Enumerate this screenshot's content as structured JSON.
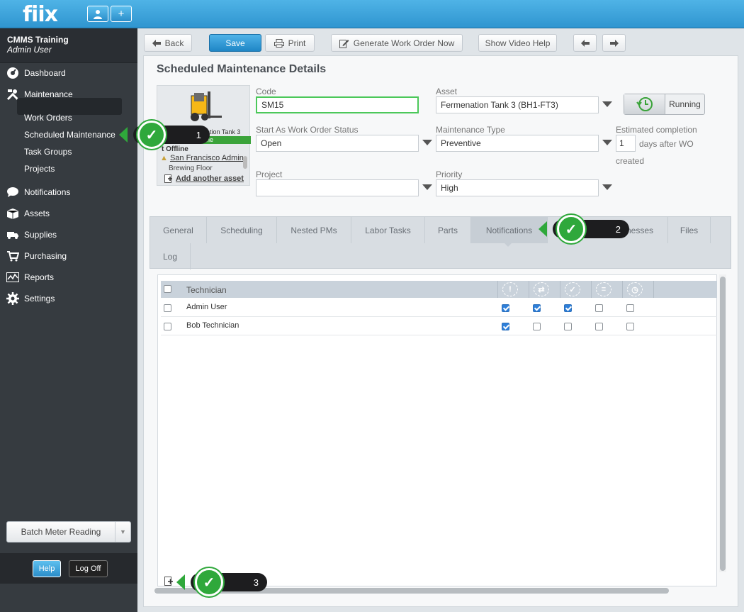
{
  "app": {
    "logo": "fiix"
  },
  "topbar": {
    "user_icon": "user-icon",
    "add_icon": "plus-icon"
  },
  "sidebar": {
    "company": "CMMS Training",
    "user": "Admin User",
    "nav": [
      {
        "label": "Dashboard",
        "icon": "dashboard-icon"
      },
      {
        "label": "Maintenance",
        "icon": "tools-icon"
      },
      {
        "label": "Notifications",
        "icon": "chat-icon"
      },
      {
        "label": "Assets",
        "icon": "box-icon"
      },
      {
        "label": "Supplies",
        "icon": "truck-icon"
      },
      {
        "label": "Purchasing",
        "icon": "cart-icon"
      },
      {
        "label": "Reports",
        "icon": "chart-icon"
      },
      {
        "label": "Settings",
        "icon": "gear-icon"
      }
    ],
    "maintenance_sub": [
      "Work Orders",
      "Scheduled Maintenance",
      "Task Groups",
      "Projects"
    ],
    "batch_meter": "Batch Meter Reading",
    "help": "Help",
    "logoff": "Log Off"
  },
  "toolbar": {
    "back": "Back",
    "save": "Save",
    "print": "Print",
    "generate": "Generate Work Order Now",
    "video_help": "Show Video Help"
  },
  "page": {
    "title": "Scheduled Maintenance Details"
  },
  "asset_card": {
    "asset_name": "Fermenation Tank 3",
    "online_label": "Online",
    "offline_label": "t Offline",
    "site": "San Francisco Admin",
    "location": "Brewing Floor",
    "add_asset": "Add another asset"
  },
  "form": {
    "code_label": "Code",
    "code_value": "SM15",
    "asset_label": "Asset",
    "asset_value": "Fermenation Tank 3 (BH1-FT3)",
    "running_label": "Running",
    "status_label": "Start As Work Order Status",
    "status_value": "Open",
    "mtype_label": "Maintenance Type",
    "mtype_value": "Preventive",
    "est_label": "Estimated completion",
    "est_value": "1",
    "est_suffix": "days after WO",
    "est_suffix2": "created",
    "project_label": "Project",
    "project_value": "",
    "priority_label": "Priority",
    "priority_value": "High"
  },
  "tabs": [
    "General",
    "Scheduling",
    "Nested PMs",
    "Labor Tasks",
    "Parts",
    "Notifications",
    "Businesses",
    "Files",
    "Log"
  ],
  "active_tab": "Notifications",
  "table": {
    "header": "Technician",
    "columns_icons": [
      "alert-icon",
      "swap-icon",
      "check-icon",
      "list-icon",
      "clock-icon"
    ],
    "rows": [
      {
        "name": "Admin User",
        "checks": [
          true,
          true,
          true,
          false,
          false
        ]
      },
      {
        "name": "Bob Technician",
        "checks": [
          true,
          false,
          false,
          false,
          false
        ]
      }
    ]
  },
  "callouts": {
    "one": "1",
    "two": "2",
    "three": "3"
  },
  "colors": {
    "accent": "#2f95d0",
    "callout_green": "#2fa83b",
    "online_green": "#3aa33a"
  }
}
